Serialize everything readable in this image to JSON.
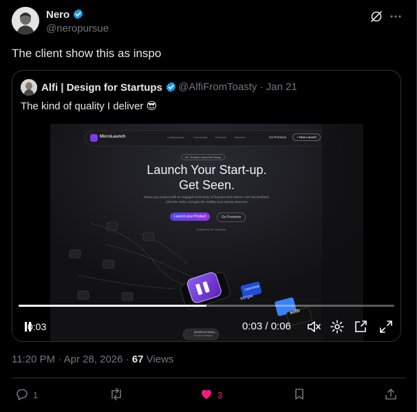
{
  "author": {
    "name": "Nero",
    "handle": "@neropursue",
    "verified": true
  },
  "post_text": "The client show this as inspo",
  "quoted": {
    "name": "Alfi | Design for Startups",
    "handle_and_date": "@AlfiFromToasty · Jan 21",
    "text": "The kind of quality I deliver 😎",
    "video": {
      "current_time": "0:03",
      "time_display": "0:03 / 0:06",
      "progress_fraction": 0.5,
      "preview": {
        "brand": "MicroLaunch",
        "nav_links": [
          "Leaderboards",
          "Community",
          "Premium",
          "Resume"
        ],
        "go_premium": "Go Premium",
        "new_launch": "+ New Launch",
        "badge": "2k+ Product Launched Today",
        "headline_1": "Launch Your Start-up.",
        "headline_2": "Get Seen.",
        "sub_1": "Share your product with an engaged community of founders and makers. Get real feedback,",
        "sub_2": "climb the ranks, and gain the visibility your startup deserves.",
        "cta_primary": "Launch your Product",
        "cta_secondary": "Go Premium",
        "trusted": "Trusted by 2k+ founders",
        "watermark_1": "@AlfiFromToasty",
        "watermark_2": "Product Designer",
        "logo_stripe": "stripe",
        "logo_softr": "softr",
        "label_launched": "Launched"
      }
    }
  },
  "timestamp": "11:20 PM · Apr 28, 2026 · ",
  "views_count": "67",
  "views_label": " Views",
  "actions": {
    "reply_count": "1",
    "repost_count": "",
    "like_count": "3"
  },
  "colors": {
    "background": "#000000",
    "text": "#e7e9ea",
    "muted": "#71767b",
    "verified": "#1d9bf0",
    "like": "#f91880",
    "border": "#2f3336"
  }
}
